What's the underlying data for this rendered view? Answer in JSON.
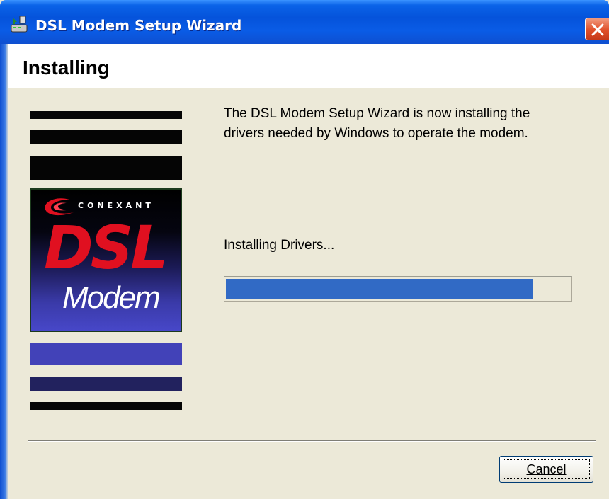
{
  "window": {
    "title": "DSL Modem Setup Wizard",
    "title_icon": "modem-setup-icon",
    "close_icon": "close-icon"
  },
  "header": {
    "title": "Installing"
  },
  "graphic": {
    "brand": "CONEXANT",
    "product_line1": "DSL",
    "product_line2": "Modem",
    "colors": {
      "dsl_red": "#e01020",
      "band_blue": "#4242b8",
      "band_navy": "#22225e"
    }
  },
  "content": {
    "description": "The DSL Modem Setup Wizard is now installing the drivers needed by Windows to operate the modem.",
    "status": "Installing Drivers...",
    "progress_fraction": 0.89,
    "progress_color": "#316ac5"
  },
  "footer": {
    "cancel_label": "Cancel"
  }
}
